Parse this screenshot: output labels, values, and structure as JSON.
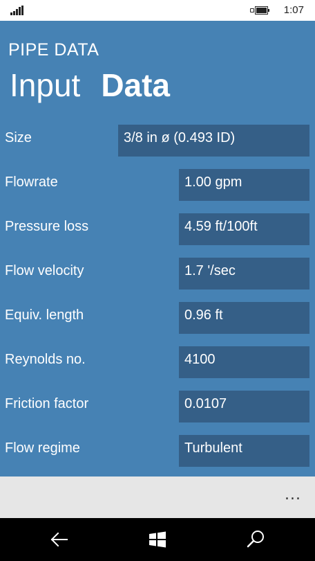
{
  "status": {
    "time": "1:07"
  },
  "app": {
    "name": "PIPE DATA",
    "title_light": "Input",
    "title_bold": "Data"
  },
  "fields": [
    {
      "label": "Size",
      "value": "3/8  in ø  (0.493 ID)"
    },
    {
      "label": "Flowrate",
      "value": "1.00 gpm"
    },
    {
      "label": "Pressure loss",
      "value": "4.59 ft/100ft"
    },
    {
      "label": "Flow velocity",
      "value": "1.7 '/sec"
    },
    {
      "label": "Equiv. length",
      "value": "0.96 ft"
    },
    {
      "label": "Reynolds no.",
      "value": "4100"
    },
    {
      "label": "Friction factor",
      "value": "0.0107"
    },
    {
      "label": "Flow regime",
      "value": "Turbulent"
    }
  ],
  "app_bar": {
    "more": "..."
  },
  "nav": {
    "back_icon": "back-arrow-icon",
    "start_icon": "windows-logo-icon",
    "search_icon": "search-icon"
  },
  "colors": {
    "accent": "#4682b4",
    "field_bg": "#355f87",
    "app_bar": "#e6e6e6",
    "nav_bar": "#000000"
  }
}
